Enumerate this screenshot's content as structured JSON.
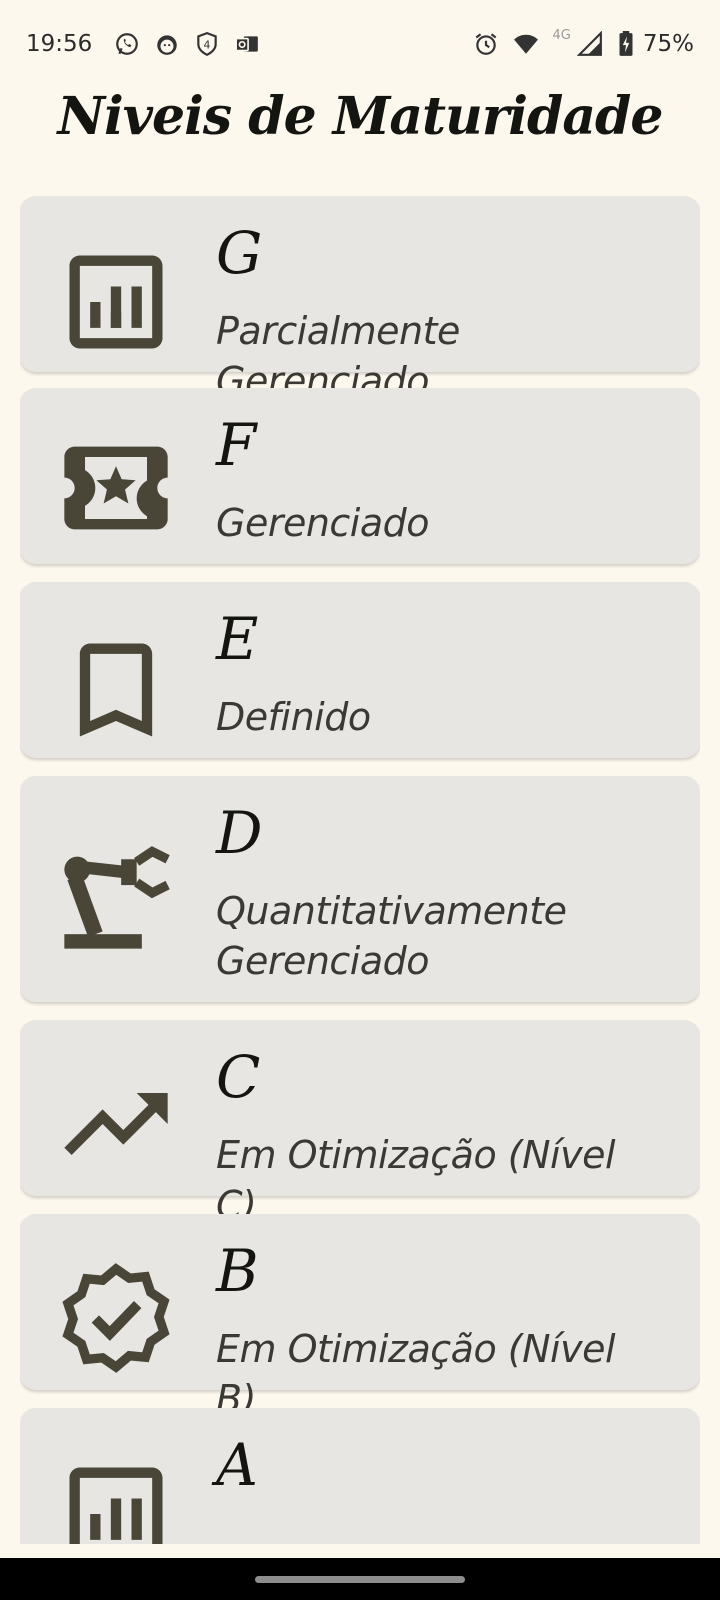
{
  "status_bar": {
    "time": "19:56",
    "left_icons": [
      "whatsapp-icon",
      "cat-app-icon",
      "shield-four-icon",
      "outlook-icon"
    ],
    "network_label": "4G",
    "battery_percent": "75%"
  },
  "title": "Niveis de Maturidade",
  "levels": [
    {
      "letter": "G",
      "name": "Parcialmente Gerenciado",
      "icon": "bar-chart-box-icon"
    },
    {
      "letter": "F",
      "name": "Gerenciado",
      "icon": "ticket-star-icon"
    },
    {
      "letter": "E",
      "name": "Definido",
      "icon": "bookmark-icon"
    },
    {
      "letter": "D",
      "name": "Quantitativamente Gerenciado",
      "icon": "robot-arm-icon"
    },
    {
      "letter": "C",
      "name": "Em Otimização (Nível C)",
      "icon": "trending-up-icon"
    },
    {
      "letter": "B",
      "name": "Em Otimização (Nível B)",
      "icon": "verified-badge-icon"
    },
    {
      "letter": "A",
      "name": "",
      "icon": "bar-chart-box-icon"
    }
  ],
  "colors": {
    "background": "#fdf8ee",
    "card": "#e7e6e3",
    "icon": "#4a4637",
    "text": "#151510"
  }
}
